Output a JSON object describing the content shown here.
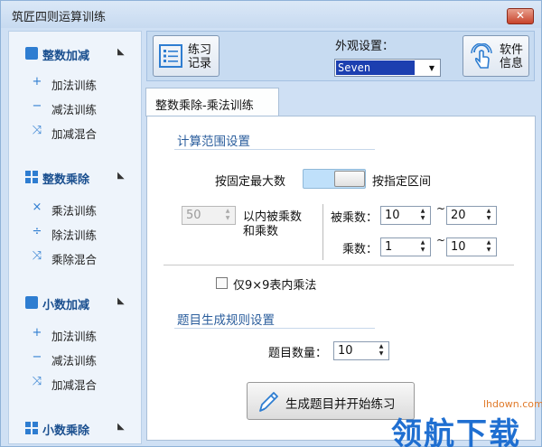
{
  "window": {
    "title": "筑匠四则运算训练",
    "close_glyph": "✕"
  },
  "sidebar": {
    "groups": [
      {
        "label": "整数加减",
        "icon": "plus-minus-icon",
        "items": [
          {
            "glyph": "+",
            "icon": "plus-icon",
            "label": "加法训练"
          },
          {
            "glyph": "−",
            "icon": "minus-icon",
            "label": "减法训练"
          },
          {
            "glyph": "⤨",
            "icon": "shuffle-icon",
            "label": "加减混合"
          }
        ]
      },
      {
        "label": "整数乘除",
        "icon": "grid-icon",
        "items": [
          {
            "glyph": "×",
            "icon": "multiply-icon",
            "label": "乘法训练"
          },
          {
            "glyph": "÷",
            "icon": "divide-icon",
            "label": "除法训练"
          },
          {
            "glyph": "⤨",
            "icon": "shuffle-icon",
            "label": "乘除混合"
          }
        ]
      },
      {
        "label": "小数加减",
        "icon": "plus-minus-icon",
        "items": [
          {
            "glyph": "+",
            "icon": "plus-icon",
            "label": "加法训练"
          },
          {
            "glyph": "−",
            "icon": "minus-icon",
            "label": "减法训练"
          },
          {
            "glyph": "⤨",
            "icon": "shuffle-icon",
            "label": "加减混合"
          }
        ]
      },
      {
        "label": "小数乘除",
        "icon": "grid-icon",
        "items": []
      }
    ]
  },
  "toolbar": {
    "records_button": {
      "line1": "练习",
      "line2": "记录"
    },
    "appearance_label": "外观设置：",
    "appearance_value": "Seven",
    "info_button": {
      "line1": "软件",
      "line2": "信息"
    }
  },
  "tab": {
    "label": "整数乘除-乘法训练"
  },
  "calc_range": {
    "title": "计算范围设置",
    "fixed_max_label": "按固定最大数",
    "interval_label": "按指定区间",
    "max_value": "50",
    "max_desc_line1": "以内被乘数",
    "max_desc_line2": "和乘数",
    "multiplicand_label": "被乘数：",
    "multiplicand_from": "10",
    "multiplicand_to": "20",
    "multiplier_label": "乘数：",
    "multiplier_from": "1",
    "multiplier_to": "10",
    "tilde": "~",
    "table_only_label": "仅9×9表内乘法",
    "table_only_checked": false
  },
  "rules": {
    "title": "题目生成规则设置",
    "count_label": "题目数量：",
    "count_value": "10"
  },
  "generate_button": {
    "label": "生成题目并开始练习"
  },
  "watermark": {
    "site": "lhdown.com",
    "logo": "领航下载"
  },
  "colors": {
    "accent": "#2e7dd1",
    "window_bg": "#cfe0f4",
    "selected_bg": "#1c3fb0"
  }
}
